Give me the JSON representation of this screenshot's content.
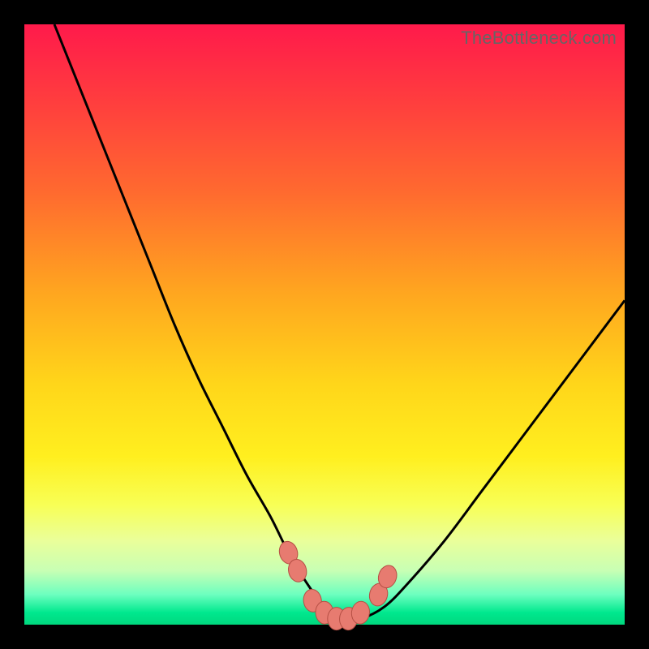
{
  "watermark": {
    "text": "TheBottleneck.com"
  },
  "colors": {
    "frame": "#000000",
    "curve_stroke": "#000000",
    "marker_fill": "#e77b70",
    "marker_stroke": "#b54f44"
  },
  "chart_data": {
    "type": "line",
    "title": "",
    "xlabel": "",
    "ylabel": "",
    "xlim": [
      0,
      100
    ],
    "ylim": [
      0,
      100
    ],
    "grid": false,
    "legend": false,
    "annotations": [
      "TheBottleneck.com"
    ],
    "series": [
      {
        "name": "bottleneck-curve",
        "x": [
          5,
          9,
          13,
          17,
          21,
          25,
          29,
          33,
          37,
          41,
          44,
          47,
          50,
          53,
          56,
          60,
          64,
          70,
          76,
          82,
          88,
          94,
          100
        ],
        "y": [
          100,
          90,
          80,
          70,
          60,
          50,
          41,
          33,
          25,
          18,
          12,
          7,
          3,
          1,
          1,
          3,
          7,
          14,
          22,
          30,
          38,
          46,
          54
        ]
      }
    ],
    "markers": {
      "name": "flat-bottom-markers",
      "x": [
        44,
        45.5,
        48,
        50,
        52,
        54,
        56,
        59,
        60.5
      ],
      "y": [
        12,
        9,
        4,
        2,
        1,
        1,
        2,
        5,
        8
      ]
    }
  }
}
